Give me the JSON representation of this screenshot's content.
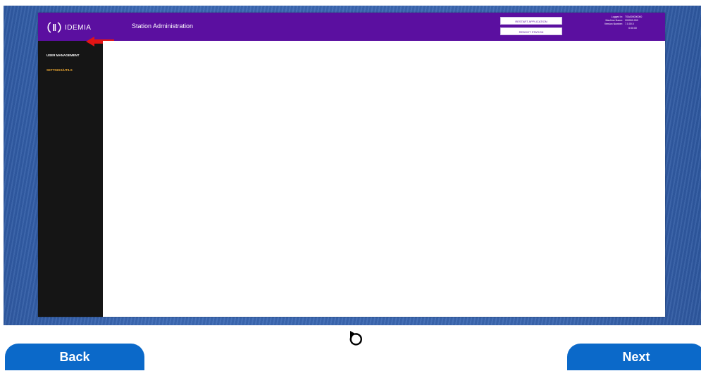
{
  "app": {
    "logo_text": "IDEMIA",
    "title": "Station Administration"
  },
  "header_buttons": {
    "restart": "RESTART APPLICATION",
    "reboot": "REBOOT STATION"
  },
  "info": {
    "rows": [
      {
        "key": "Logged in:",
        "value": "TSA000000000"
      },
      {
        "key": "Machine Name:",
        "value": "000000-000"
      },
      {
        "key": "Version Number:",
        "value": "7.0.00.0"
      }
    ],
    "time": "0:00:00"
  },
  "sidebar": {
    "items": [
      {
        "label": "USER MANAGEMENT"
      },
      {
        "label": "SETTINGS/UTILS"
      }
    ]
  },
  "footer": {
    "back_label": "Back",
    "next_label": "Next"
  },
  "colors": {
    "header_purple": "#5b0fa0",
    "sidebar_black": "#151515",
    "selected_item": "#e8a531",
    "nav_button_blue": "#0b69c9",
    "arrow_red": "#e31414"
  },
  "icons": [
    "idemia-logo-icon",
    "red-arrow-icon",
    "reload-icon"
  ]
}
